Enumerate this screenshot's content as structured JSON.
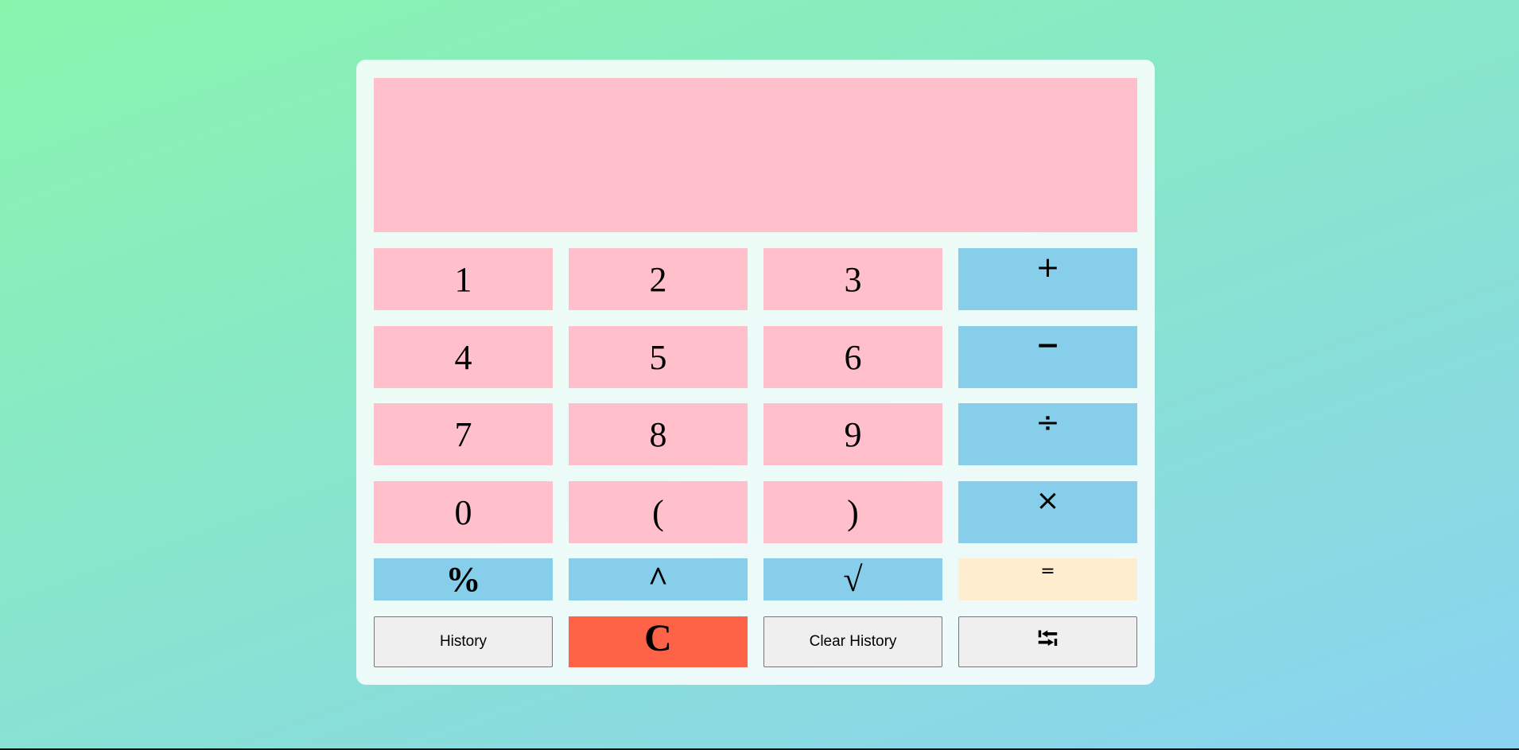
{
  "display": {
    "value": ""
  },
  "keypad": {
    "row1": {
      "k1": "1",
      "k2": "2",
      "k3": "3",
      "op": "+"
    },
    "row2": {
      "k1": "4",
      "k2": "5",
      "k3": "6",
      "op": "−"
    },
    "row3": {
      "k1": "7",
      "k2": "8",
      "k3": "9",
      "op": "÷"
    },
    "row4": {
      "k1": "0",
      "k2": "(",
      "k3": ")",
      "op": "×"
    },
    "row5": {
      "percent": "%",
      "power": "^",
      "sqrt": "√",
      "equals": "="
    },
    "row6": {
      "history": "History",
      "clear": "C",
      "clear_history": "Clear History",
      "backspace": "⭾"
    }
  },
  "colors": {
    "digit": "#ffc0cb",
    "operator": "#87ceeb",
    "equals": "#ffedd0",
    "clear": "#ff6347",
    "plain": "#efefef"
  },
  "icons": {
    "backspace": "tab-arrows-icon"
  }
}
